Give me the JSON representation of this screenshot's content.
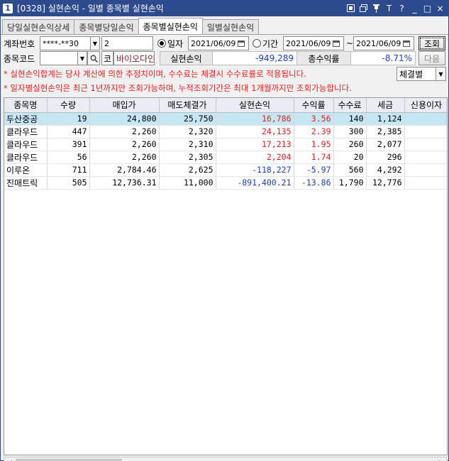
{
  "titlebar": {
    "window_number": "1",
    "title": "[0328] 실현손익 - 일별 종목별 실현손익",
    "tools": [
      "restore-icon",
      "window-icon",
      "pin-icon",
      "T",
      "?",
      "_",
      "□",
      "×"
    ]
  },
  "tabs": [
    "당일실현손익상세",
    "종목별당일손익",
    "종목별실현손익",
    "일별실현손익"
  ],
  "active_tab": "종목별실현손익",
  "form": {
    "account_label": "계좌번호",
    "account_value": "****-**30",
    "password_value": "2",
    "date_label": "일자",
    "date_value": "2021/06/09",
    "period_label": "기간",
    "period_start": "2021/06/09",
    "period_sep": "~",
    "period_end": "2021/06/09",
    "query_button": "조회",
    "code_label": "종목코드",
    "code_value": "",
    "market_badge": "코",
    "stock_name": "바이오다인",
    "realized_label": "실현손익",
    "realized_value": "-949,289",
    "total_rate_label": "총수익률",
    "total_rate_value": "-8.71%",
    "next_button": "다음"
  },
  "notes": {
    "note1": "* 실현손익합계는 당사 계산에 의한 추정치이며, 수수료는 체결시 수수료률로 적용됩니다.",
    "note2": "* 일자별실현손익은 최근 1년까지만 조회가능하며, 누적조회기간은 최대 1개월까지만 조회가능합니다.",
    "select_value": "체결별"
  },
  "table": {
    "columns": [
      "종목명",
      "수량",
      "매입가",
      "매도체결가",
      "실현손익",
      "수익률",
      "수수료",
      "세금",
      "신용이자"
    ],
    "rows": [
      {
        "name": "두산중공",
        "qty": "19",
        "buy": "24,800",
        "sell": "25,750",
        "pnl": "16,786",
        "rate": "3.56",
        "fee": "140",
        "tax": "1,124",
        "interest": "",
        "sign": "pos"
      },
      {
        "name": "클라우드",
        "qty": "447",
        "buy": "2,260",
        "sell": "2,320",
        "pnl": "24,135",
        "rate": "2.39",
        "fee": "300",
        "tax": "2,385",
        "interest": "",
        "sign": "pos"
      },
      {
        "name": "클라우드",
        "qty": "391",
        "buy": "2,260",
        "sell": "2,310",
        "pnl": "17,213",
        "rate": "1.95",
        "fee": "260",
        "tax": "2,077",
        "interest": "",
        "sign": "pos"
      },
      {
        "name": "클라우드",
        "qty": "56",
        "buy": "2,260",
        "sell": "2,305",
        "pnl": "2,204",
        "rate": "1.74",
        "fee": "20",
        "tax": "296",
        "interest": "",
        "sign": "pos"
      },
      {
        "name": "이루온",
        "qty": "711",
        "buy": "2,784.46",
        "sell": "2,625",
        "pnl": "-118,227",
        "rate": "-5.97",
        "fee": "560",
        "tax": "4,292",
        "interest": "",
        "sign": "neg"
      },
      {
        "name": "진매트릭",
        "qty": "505",
        "buy": "12,736.31",
        "sell": "11,000",
        "pnl": "-891,400.21",
        "rate": "-13.86",
        "fee": "1,790",
        "tax": "12,776",
        "interest": "",
        "sign": "neg"
      }
    ]
  },
  "colors": {
    "titlebar": "#2c4a8c",
    "positive": "#e02020",
    "negative": "#1a3fc0",
    "highlight_row": "#c5e6f5"
  }
}
